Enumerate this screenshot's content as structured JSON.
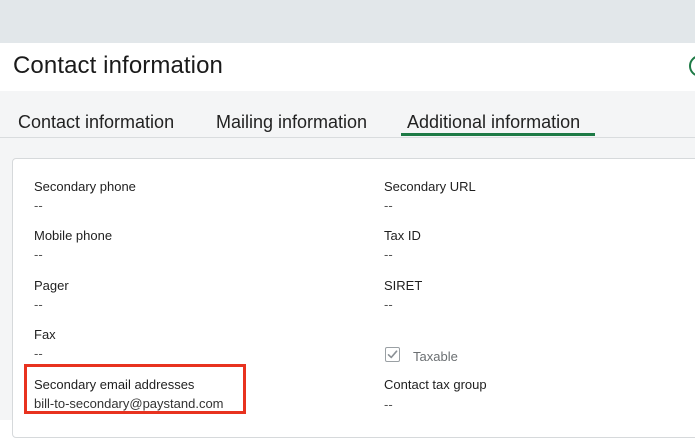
{
  "header": {
    "title": "Contact information"
  },
  "tabs": [
    {
      "label": "Contact information",
      "active": false
    },
    {
      "label": "Mailing information",
      "active": false
    },
    {
      "label": "Additional information",
      "active": true
    }
  ],
  "fields": {
    "secondary_phone": {
      "label": "Secondary phone",
      "value": "--"
    },
    "mobile_phone": {
      "label": "Mobile phone",
      "value": "--"
    },
    "pager": {
      "label": "Pager",
      "value": "--"
    },
    "fax": {
      "label": "Fax",
      "value": "--"
    },
    "secondary_email": {
      "label": "Secondary email addresses",
      "value": "bill-to-secondary@paystand.com"
    },
    "secondary_url": {
      "label": "Secondary URL",
      "value": "--"
    },
    "tax_id": {
      "label": "Tax ID",
      "value": "--"
    },
    "siret": {
      "label": "SIRET",
      "value": "--"
    },
    "taxable": {
      "label": "Taxable",
      "checked": true
    },
    "contact_tax_group": {
      "label": "Contact tax group",
      "value": "--"
    }
  },
  "colors": {
    "accent": "#1d7a45",
    "highlight": "#e8321f"
  }
}
